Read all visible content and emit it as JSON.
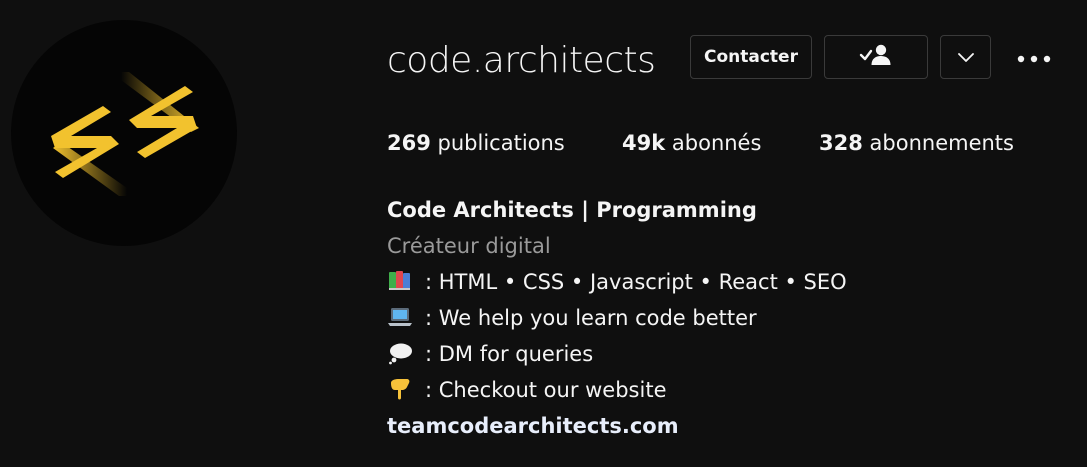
{
  "profile": {
    "username": "code.architects",
    "buttons": {
      "contact": "Contacter"
    },
    "stats": {
      "posts_count": "269",
      "posts_label": "publications",
      "followers_count": "49k",
      "followers_label": "abonnés",
      "following_count": "328",
      "following_label": "abonnements"
    },
    "bio": {
      "name": "Code Architects | Programming",
      "category": "Créateur digital",
      "lines": [
        ": HTML • CSS • Javascript • React • SEO",
        ": We help you learn code better",
        ": DM for queries",
        ": Checkout our website"
      ],
      "line_icons": [
        "books-emoji-icon",
        "laptop-emoji-icon",
        "thought-bubble-emoji-icon",
        "pointing-down-emoji-icon"
      ],
      "link": "teamcodearchitects.com"
    },
    "icons": {
      "following_button": "person-check-icon",
      "dropdown": "chevron-down-icon",
      "more": "more-dots-icon"
    },
    "colors": {
      "background": "#0f0f0f",
      "text": "#f5f5f5",
      "muted": "#9a9a9a",
      "button_border": "#3a3a3a",
      "logo_gold": "#f2c22e"
    }
  }
}
